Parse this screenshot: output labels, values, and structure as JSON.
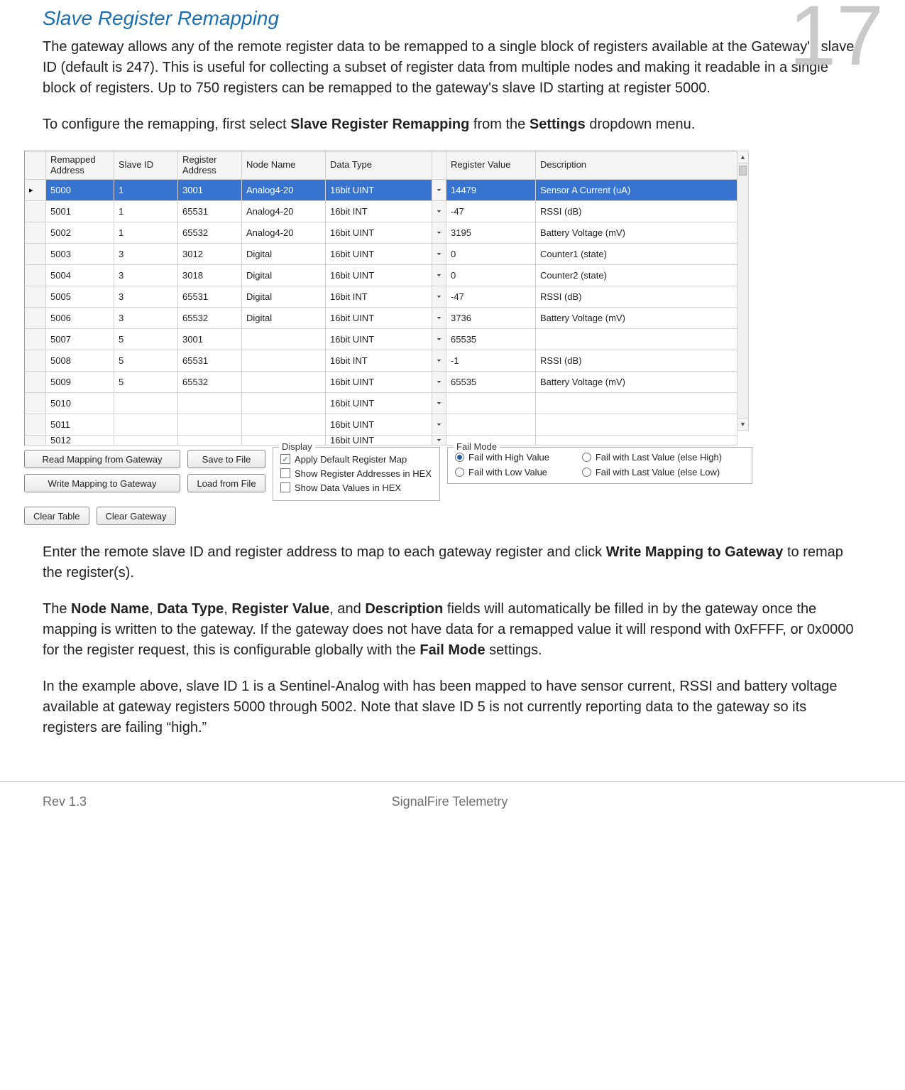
{
  "page_number": "17",
  "section_title": "Slave Register Remapping",
  "intro_paragraph": "The gateway allows any of the remote register data to be remapped to a single block of registers available at the Gateway's slave ID (default is 247). This is useful for collecting a subset of register data from multiple nodes and making it readable in a single block of registers. Up to 750 registers can be remapped to the gateway's slave ID starting at register 5000.",
  "config_text_prefix": "To configure the remapping, first select ",
  "config_text_bold1": "Slave Register Remapping",
  "config_text_mid": " from the ",
  "config_text_bold2": "Settings",
  "config_text_suffix": " dropdown menu.",
  "table": {
    "headers": {
      "remapped": "Remapped Address",
      "slave": "Slave ID",
      "regaddr": "Register Address",
      "node": "Node Name",
      "dtype": "Data Type",
      "regval": "Register Value",
      "desc": "Description"
    },
    "rows": [
      {
        "remapped": "5000",
        "slave": "1",
        "regaddr": "3001",
        "node": "Analog4-20",
        "dtype": "16bit UINT",
        "regval": "14479",
        "desc": "Sensor A Current (uA)",
        "selected": true
      },
      {
        "remapped": "5001",
        "slave": "1",
        "regaddr": "65531",
        "node": "Analog4-20",
        "dtype": "16bit INT",
        "regval": "-47",
        "desc": "RSSI (dB)"
      },
      {
        "remapped": "5002",
        "slave": "1",
        "regaddr": "65532",
        "node": "Analog4-20",
        "dtype": "16bit UINT",
        "regval": "3195",
        "desc": "Battery Voltage (mV)"
      },
      {
        "remapped": "5003",
        "slave": "3",
        "regaddr": "3012",
        "node": "Digital",
        "dtype": "16bit UINT",
        "regval": "0",
        "desc": "Counter1 (state)"
      },
      {
        "remapped": "5004",
        "slave": "3",
        "regaddr": "3018",
        "node": "Digital",
        "dtype": "16bit UINT",
        "regval": "0",
        "desc": "Counter2 (state)"
      },
      {
        "remapped": "5005",
        "slave": "3",
        "regaddr": "65531",
        "node": "Digital",
        "dtype": "16bit INT",
        "regval": "-47",
        "desc": "RSSI (dB)"
      },
      {
        "remapped": "5006",
        "slave": "3",
        "regaddr": "65532",
        "node": "Digital",
        "dtype": "16bit UINT",
        "regval": "3736",
        "desc": "Battery Voltage (mV)"
      },
      {
        "remapped": "5007",
        "slave": "5",
        "regaddr": "3001",
        "node": "",
        "dtype": "16bit UINT",
        "regval": "65535",
        "desc": ""
      },
      {
        "remapped": "5008",
        "slave": "5",
        "regaddr": "65531",
        "node": "",
        "dtype": "16bit INT",
        "regval": "-1",
        "desc": "RSSI (dB)"
      },
      {
        "remapped": "5009",
        "slave": "5",
        "regaddr": "65532",
        "node": "",
        "dtype": "16bit UINT",
        "regval": "65535",
        "desc": "Battery Voltage (mV)"
      },
      {
        "remapped": "5010",
        "slave": "",
        "regaddr": "",
        "node": "",
        "dtype": "16bit UINT",
        "regval": "",
        "desc": ""
      },
      {
        "remapped": "5011",
        "slave": "",
        "regaddr": "",
        "node": "",
        "dtype": "16bit UINT",
        "regval": "",
        "desc": ""
      }
    ],
    "cut_row": {
      "remapped": "5012",
      "dtype": "16bit UINT"
    }
  },
  "buttons": {
    "read_mapping": "Read Mapping from Gateway",
    "write_mapping": "Write Mapping to Gateway",
    "save_file": "Save to File",
    "load_file": "Load from File",
    "clear_table": "Clear Table",
    "clear_gateway": "Clear Gateway"
  },
  "display_group": {
    "legend": "Display",
    "opt1": {
      "label": "Apply Default Register Map",
      "checked": true
    },
    "opt2": {
      "label": "Show Register Addresses in HEX",
      "checked": false
    },
    "opt3": {
      "label": "Show Data Values in HEX",
      "checked": false
    }
  },
  "failmode_group": {
    "legend": "Fail Mode",
    "opts": [
      {
        "label": "Fail with High Value",
        "checked": true
      },
      {
        "label": "Fail with Last Value (else High)",
        "checked": false
      },
      {
        "label": "Fail with Low Value",
        "checked": false
      },
      {
        "label": "Fail with Last Value (else Low)",
        "checked": false
      }
    ]
  },
  "para2_prefix": "Enter the remote slave ID and register address to map to each gateway register and click ",
  "para2_bold": "Write Mapping to Gateway",
  "para2_suffix": " to remap the register(s).",
  "para3_prefix": "The ",
  "para3_b1": "Node Name",
  "para3_s1": ", ",
  "para3_b2": "Data Type",
  "para3_s2": ", ",
  "para3_b3": "Register Value",
  "para3_s3": ", and ",
  "para3_b4": "Description",
  "para3_mid": " fields will automatically be filled in by the gateway once the mapping is written to the gateway. If the gateway does not have data for a remapped value it will respond with 0xFFFF, or 0x0000 for the register request, this is configurable globally with the ",
  "para3_b5": "Fail Mode",
  "para3_suffix": " settings.",
  "para4": "In the example above, slave ID 1 is a Sentinel-Analog with has been mapped to have sensor current, RSSI and battery voltage available at gateway registers 5000 through 5002. Note that slave ID 5 is not currently reporting data to the gateway so its registers are failing “high.”",
  "footer": {
    "rev": "Rev 1.3",
    "company": "SignalFire Telemetry"
  }
}
